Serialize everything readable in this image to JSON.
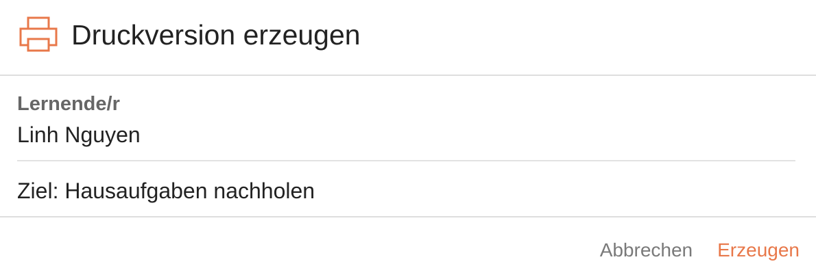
{
  "dialog": {
    "title": "Druckversion erzeugen",
    "icon": "printer-icon",
    "accent_color": "#e8784a"
  },
  "learner": {
    "label": "Lernende/r",
    "value": "Linh Nguyen"
  },
  "goal": {
    "text": "Ziel: Hausaufgaben nachholen"
  },
  "actions": {
    "cancel_label": "Abbrechen",
    "confirm_label": "Erzeugen"
  }
}
